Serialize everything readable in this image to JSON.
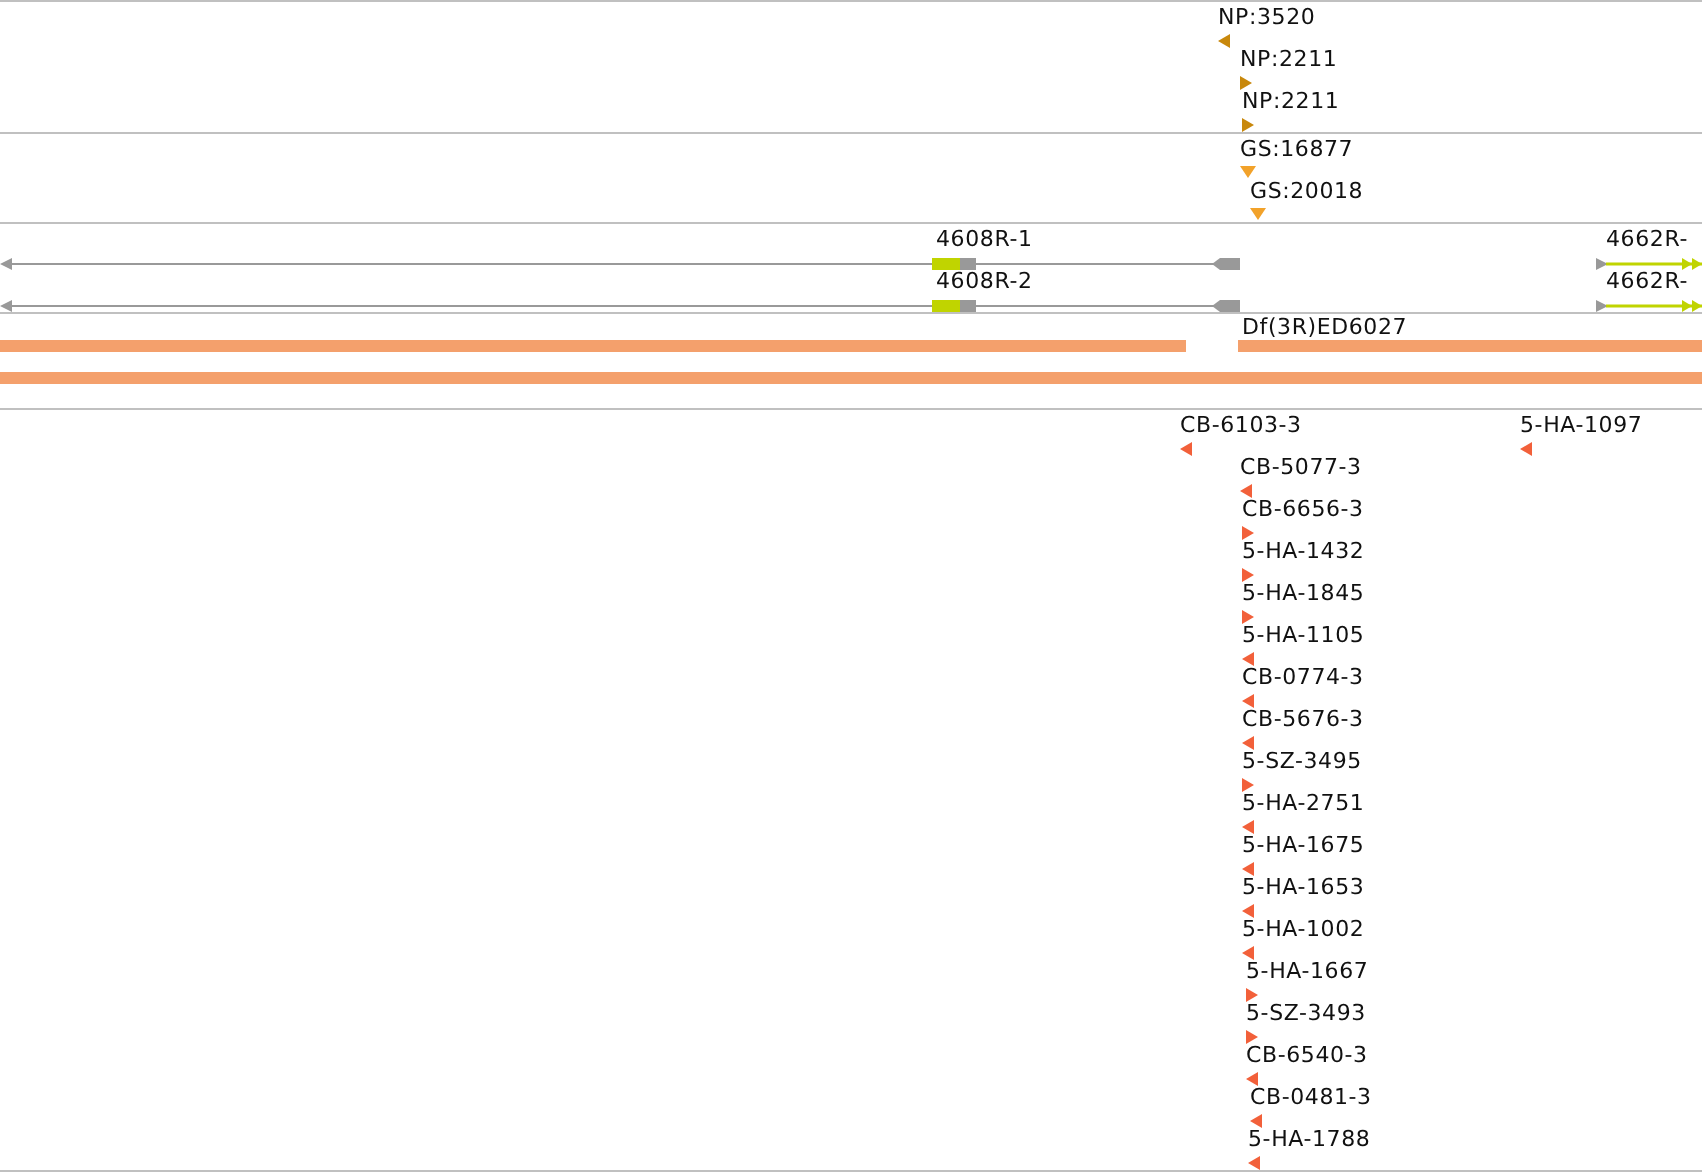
{
  "tracks": [
    {
      "kind": "features",
      "color": "#c8880c",
      "features": [
        {
          "label": "NP:3520",
          "kind": "reverse"
        },
        {
          "label": "NP:2211",
          "kind": "forward"
        },
        {
          "label": "NP:2211",
          "kind": "forward"
        }
      ]
    },
    {
      "kind": "features",
      "color": "#f2a22a",
      "features": [
        {
          "label": "GS:16877",
          "kind": "unstranded"
        },
        {
          "label": "GS:20018",
          "kind": "unstranded"
        }
      ]
    },
    {
      "kind": "genes",
      "genes": [
        {
          "label": "4608R-1"
        },
        {
          "label": "4608R-2"
        },
        {
          "label": "4662R-"
        },
        {
          "label": "4662R-"
        }
      ]
    },
    {
      "kind": "bars",
      "color": "#f4a06c",
      "label": "Df(3R)ED6027"
    },
    {
      "kind": "features",
      "color": "#f2603a",
      "features": [
        {
          "label": "CB-6103-3",
          "kind": "reverse"
        },
        {
          "label": "5-HA-1097",
          "kind": "reverse"
        },
        {
          "label": "CB-5077-3",
          "kind": "reverse"
        },
        {
          "label": "CB-6656-3",
          "kind": "forward"
        },
        {
          "label": "5-HA-1432",
          "kind": "forward"
        },
        {
          "label": "5-HA-1845",
          "kind": "forward"
        },
        {
          "label": "5-HA-1105",
          "kind": "reverse"
        },
        {
          "label": "CB-0774-3",
          "kind": "reverse"
        },
        {
          "label": "CB-5676-3",
          "kind": "reverse"
        },
        {
          "label": "5-SZ-3495",
          "kind": "forward"
        },
        {
          "label": "5-HA-2751",
          "kind": "reverse"
        },
        {
          "label": "5-HA-1675",
          "kind": "reverse"
        },
        {
          "label": "5-HA-1653",
          "kind": "reverse"
        },
        {
          "label": "5-HA-1002",
          "kind": "reverse"
        },
        {
          "label": "5-HA-1667",
          "kind": "forward"
        },
        {
          "label": "5-SZ-3493",
          "kind": "forward"
        },
        {
          "label": "CB-6540-3",
          "kind": "reverse"
        },
        {
          "label": "CB-0481-3",
          "kind": "reverse"
        },
        {
          "label": "5-HA-1788",
          "kind": "reverse"
        }
      ]
    }
  ]
}
